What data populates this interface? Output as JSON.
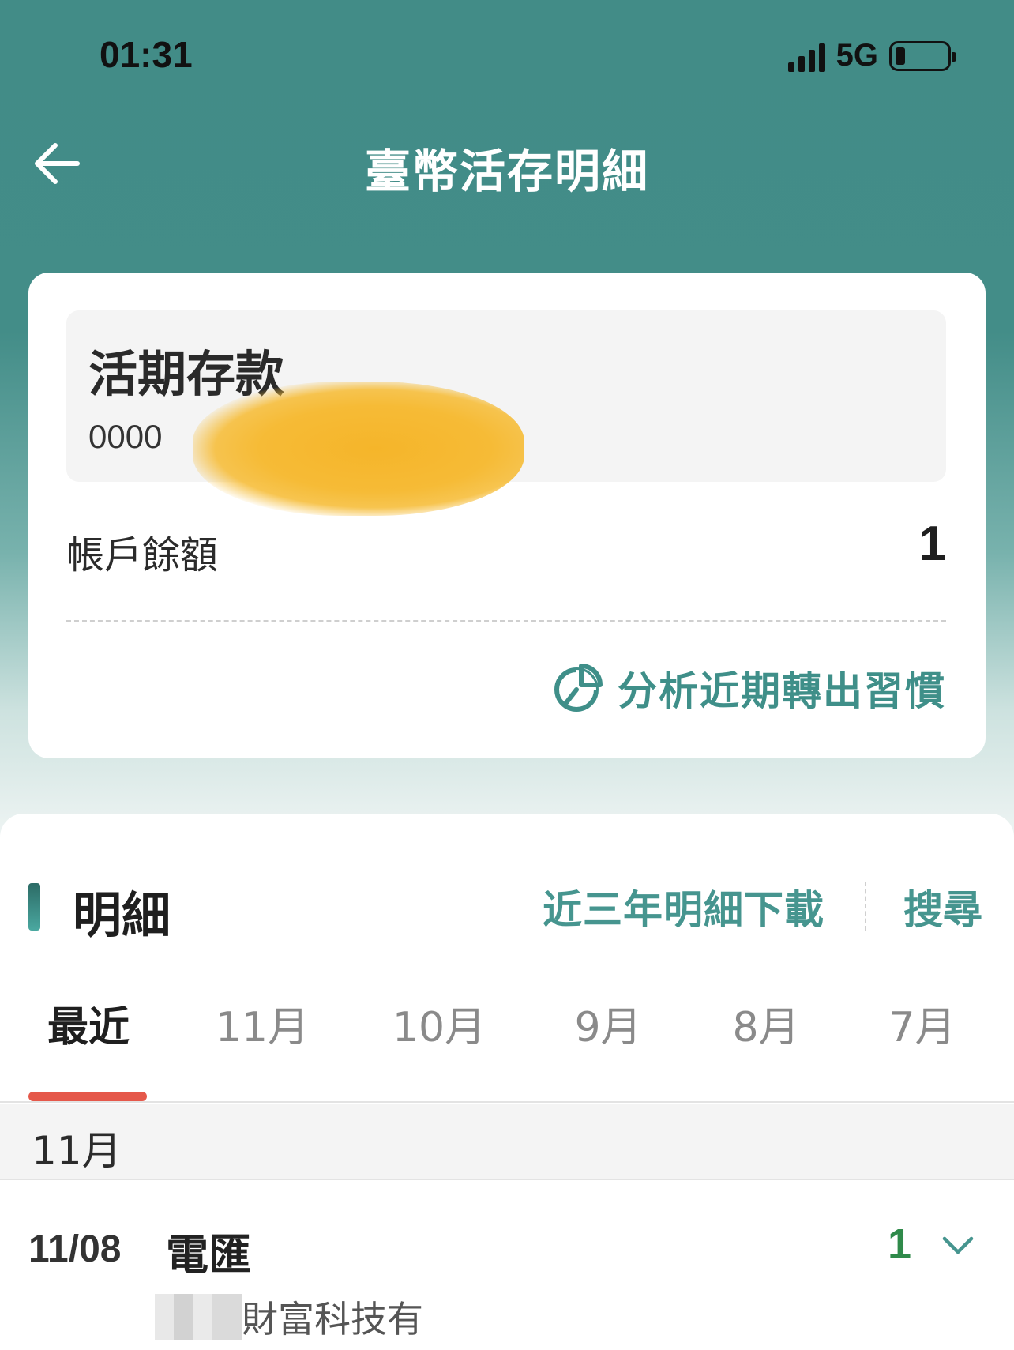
{
  "status_bar": {
    "time": "01:31",
    "network": "5G",
    "icons": [
      "signal-icon",
      "battery-icon"
    ]
  },
  "nav": {
    "title": "臺幣活存明細",
    "back_icon": "arrow-left-icon"
  },
  "account": {
    "type": "活期存款",
    "number_visible": "0000",
    "balance_label": "帳戶餘額",
    "balance_value": "1",
    "analysis_label": "分析近期轉出習慣",
    "analysis_icon": "pie-chart-icon"
  },
  "details": {
    "title": "明細",
    "download_label": "近三年明細下載",
    "search_label": "搜尋",
    "tabs": [
      {
        "label": "最近",
        "active": true
      },
      {
        "label": "11月",
        "active": false
      },
      {
        "label": "10月",
        "active": false
      },
      {
        "label": "9月",
        "active": false
      },
      {
        "label": "8月",
        "active": false
      },
      {
        "label": "7月",
        "active": false
      }
    ],
    "month_header": "11月",
    "transactions": [
      {
        "date": "11/08",
        "type": "電匯",
        "amount": "1",
        "counterparty": "財富科技有",
        "expand_icon": "chevron-down-icon"
      }
    ]
  },
  "colors": {
    "header_teal": "#428c87",
    "accent_teal": "#46958f",
    "active_tab_underline": "#e5584a",
    "positive_amount": "#2f8a4a"
  }
}
